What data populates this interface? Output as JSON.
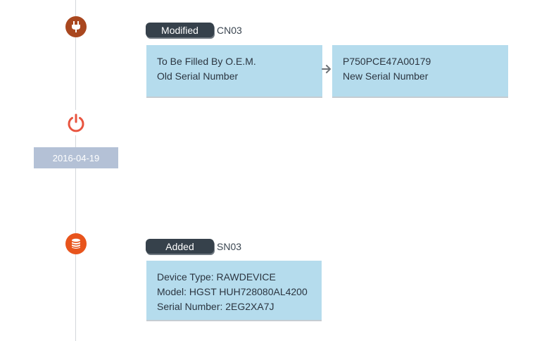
{
  "timeline": {
    "events": [
      {
        "icon": "power-plug-icon",
        "icon_color": "#a9471f",
        "badge": "Modified",
        "id": "CN03",
        "old_value": "To Be Filled By O.E.M.",
        "old_label": "Old Serial Number",
        "new_value": "P750PCE47A00179",
        "new_label": "New Serial Number"
      },
      {
        "icon": "power-icon",
        "icon_color": "#e8543f",
        "date": "2016-04-19"
      },
      {
        "icon": "database-icon",
        "icon_color": "#e8541c",
        "badge": "Added",
        "id": "SN03",
        "details": [
          "Device Type: RAWDEVICE",
          "Model: HGST HUH728080AL4200",
          "Serial Number: 2EG2XA7J"
        ]
      }
    ]
  },
  "colors": {
    "badge_bg": "#36414b",
    "card_bg": "#b5dced",
    "date_bg": "#b4c1d6",
    "timeline_line": "#d3d7db"
  }
}
